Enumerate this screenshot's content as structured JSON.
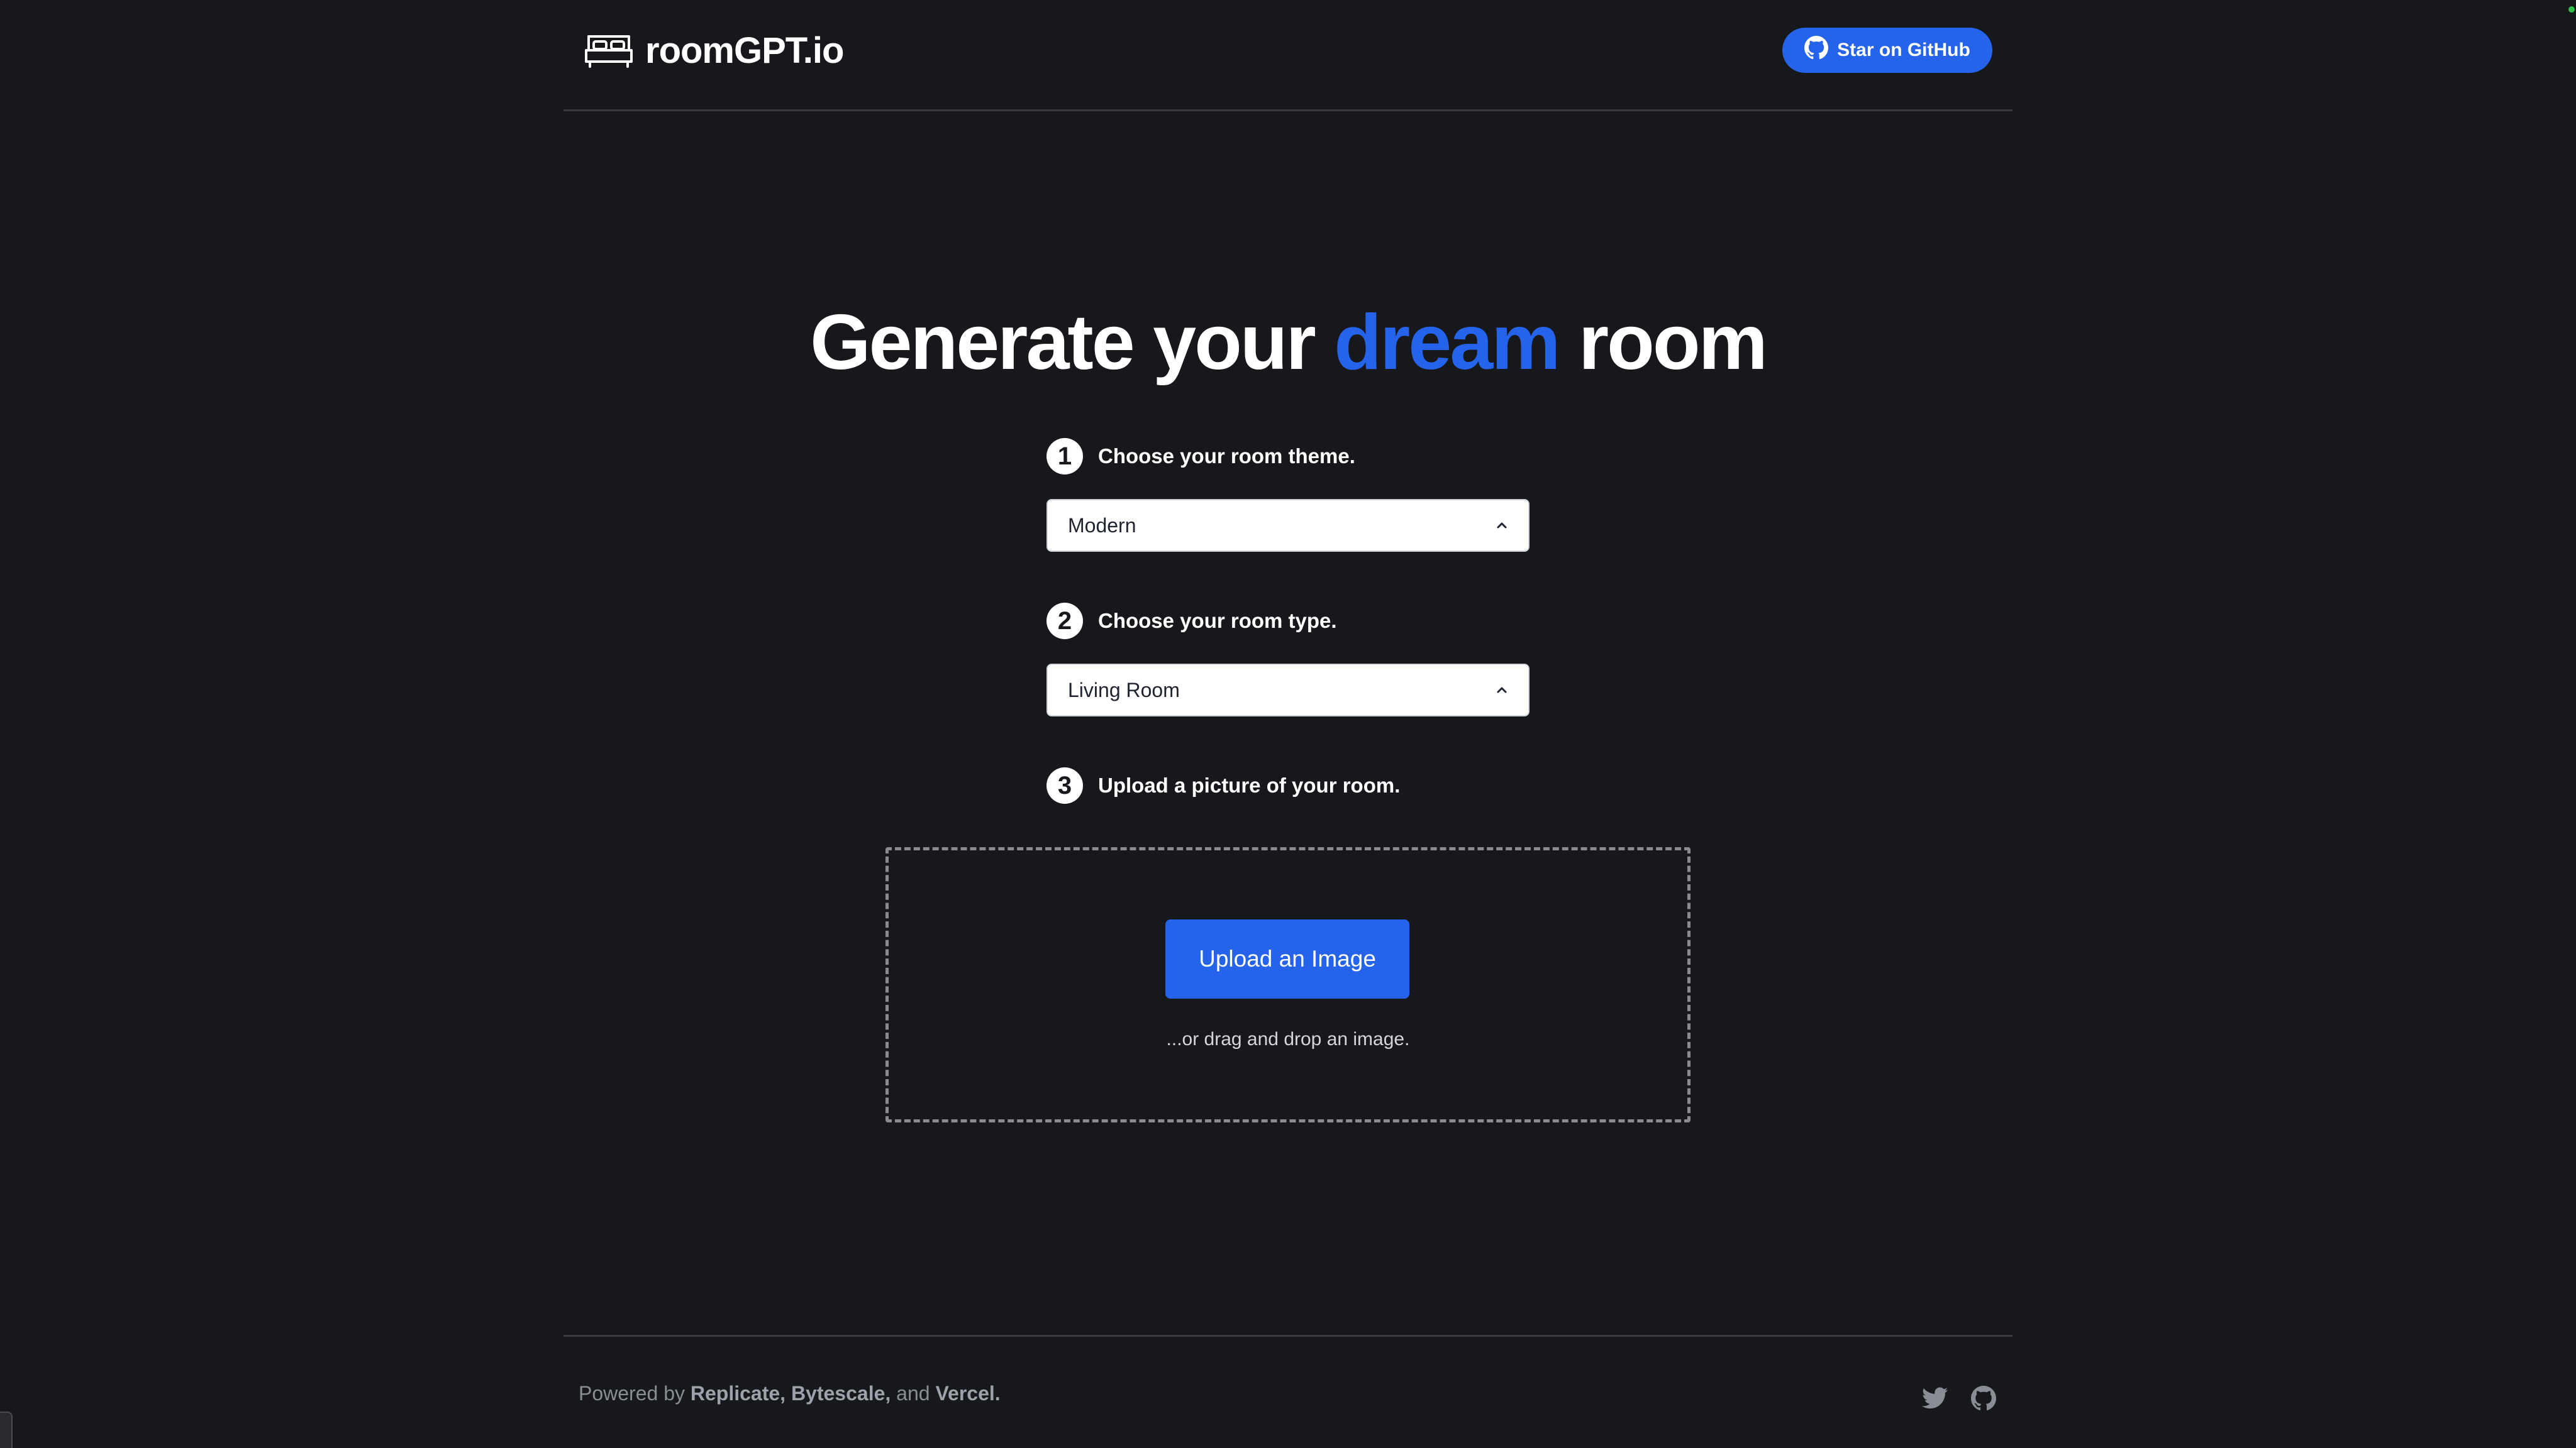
{
  "header": {
    "brand": "roomGPT.io",
    "github_button_label": "Star on GitHub"
  },
  "hero": {
    "title_before": "Generate your",
    "title_accent": "dream",
    "title_after": "room"
  },
  "steps": [
    {
      "number": "1",
      "label": "Choose your room theme.",
      "selected": "Modern"
    },
    {
      "number": "2",
      "label": "Choose your room type.",
      "selected": "Living Room"
    },
    {
      "number": "3",
      "label": "Upload a picture of your room."
    }
  ],
  "upload": {
    "button_label": "Upload an Image",
    "hint": "...or drag and drop an image."
  },
  "footer": {
    "powered_prefix": "Powered by",
    "replicate": "Replicate,",
    "bytescale": "Bytescale,",
    "and": "and",
    "vercel": "Vercel."
  },
  "colors": {
    "background": "#17181c",
    "accent": "#2563eb"
  }
}
